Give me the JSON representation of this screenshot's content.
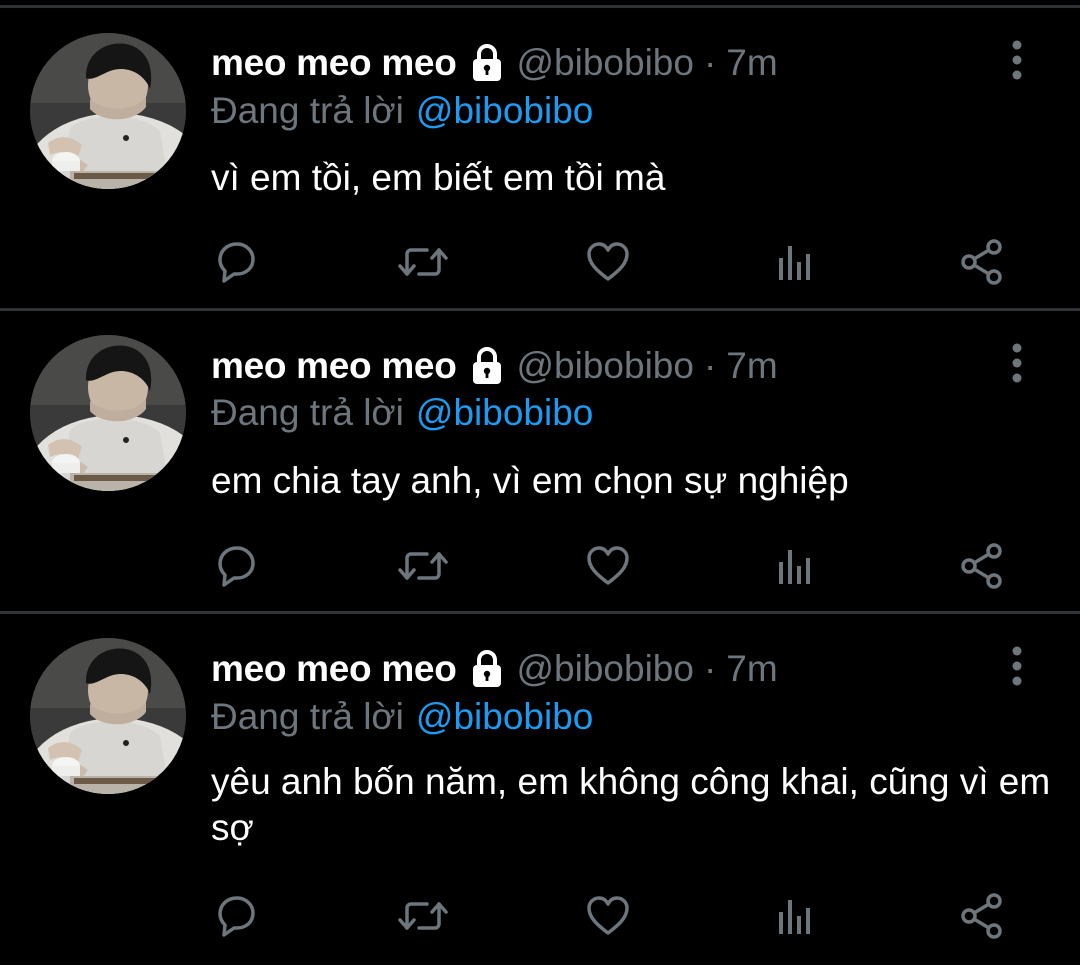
{
  "colors": {
    "background": "#000000",
    "divider": "#2f3336",
    "name": "#ffffff",
    "muted": "#6e767d",
    "link": "#1d9bf0",
    "icon": "#6e767d"
  },
  "tweets": [
    {
      "display_name": "meo meo meo",
      "handle": "@bibobibo",
      "separator": "·",
      "time": "7m",
      "reply_prefix": "Đang trả lời",
      "reply_handle": "@bibobibo",
      "text": "vì em tồi, em biết em tồi mà"
    },
    {
      "display_name": "meo meo meo",
      "handle": "@bibobibo",
      "separator": "·",
      "time": "7m",
      "reply_prefix": "Đang trả lời",
      "reply_handle": "@bibobibo",
      "text": "em chia tay anh, vì em chọn sự nghiệp"
    },
    {
      "display_name": "meo meo meo",
      "handle": "@bibobibo",
      "separator": "·",
      "time": "7m",
      "reply_prefix": "Đang trả lời",
      "reply_handle": "@bibobibo",
      "text": "yêu anh bốn năm, em không công khai, cũng vì em sợ"
    }
  ],
  "icons": {
    "lock": "lock-icon",
    "more": "more-vertical-icon",
    "reply": "reply-icon",
    "retweet": "retweet-icon",
    "like": "heart-icon",
    "analytics": "analytics-icon",
    "share": "share-icon"
  }
}
